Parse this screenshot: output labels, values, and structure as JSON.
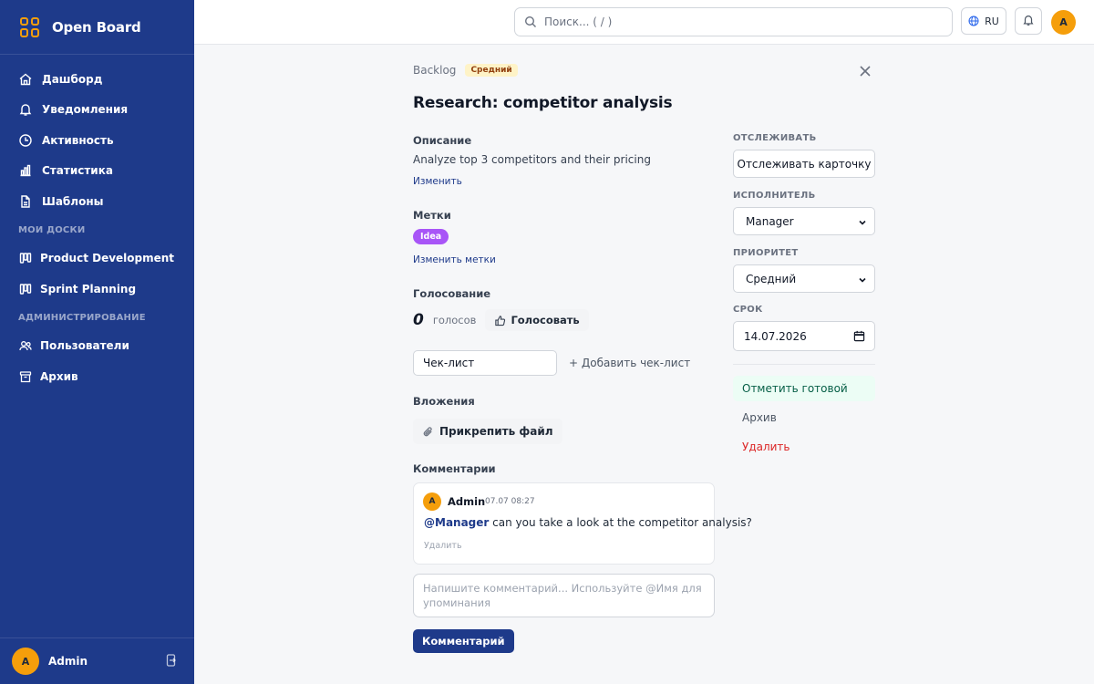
{
  "app": {
    "name": "Open Board"
  },
  "sidebar": {
    "items": [
      {
        "label": "Дашборд",
        "icon": "home-icon"
      },
      {
        "label": "Уведомления",
        "icon": "bell-icon"
      },
      {
        "label": "Активность",
        "icon": "clock-icon"
      },
      {
        "label": "Статистика",
        "icon": "chart-icon"
      },
      {
        "label": "Шаблоны",
        "icon": "document-icon"
      }
    ],
    "boards_section": "МОИ ДОСКИ",
    "boards": [
      {
        "label": "Product Development",
        "icon": "board-icon"
      },
      {
        "label": "Sprint Planning",
        "icon": "board-icon"
      }
    ],
    "admin_section": "АДМИНИСТРИРОВАНИЕ",
    "admin_items": [
      {
        "label": "Пользователи",
        "icon": "users-icon"
      },
      {
        "label": "Архив",
        "icon": "archive-icon"
      }
    ],
    "user": {
      "initial": "A",
      "name": "Admin"
    }
  },
  "topbar": {
    "search_placeholder": "Поиск... ( / )",
    "language": "RU",
    "avatar_initial": "A"
  },
  "card": {
    "list_name": "Backlog",
    "priority_badge": "Средний",
    "title": "Research: competitor analysis",
    "description_label": "Описание",
    "description": "Analyze top 3 competitors and their pricing",
    "edit_link": "Изменить",
    "labels_label": "Метки",
    "tag": "Idea",
    "edit_labels_link": "Изменить метки",
    "voting_label": "Голосование",
    "vote_count": "0",
    "votes_text": "голосов",
    "vote_button": "Голосовать",
    "checklist_value": "Чек-лист",
    "add_checklist": "+ Добавить чек-лист",
    "attachments_label": "Вложения",
    "attach_button": "Прикрепить файл",
    "comments_label": "Комментарии",
    "comment": {
      "avatar_initial": "A",
      "author": "Admin",
      "time": "07.07 08:27",
      "mention": "@Manager",
      "text": " can you take a look at the competitor analysis?",
      "delete": "Удалить"
    },
    "comment_placeholder": "Напишите комментарий... Используйте @Имя для упоминания",
    "comment_button": "Комментарий"
  },
  "right_panel": {
    "watch_label": "ОТСЛЕЖИВАТЬ",
    "watch_button": "Отслеживать карточку",
    "assignee_label": "ИСПОЛНИТЕЛЬ",
    "assignee_value": "Manager",
    "priority_label": "ПРИОРИТЕТ",
    "priority_value": "Средний",
    "due_label": "СРОК",
    "due_value": "14.07.2026",
    "mark_done": "Отметить готовой",
    "archive": "Архив",
    "delete": "Удалить"
  },
  "colors": {
    "sidebar": "#1e3a8a",
    "accent": "#f59e0b",
    "tag": "#a855f7",
    "danger": "#dc2626",
    "success_bg": "#ecfdf5"
  }
}
